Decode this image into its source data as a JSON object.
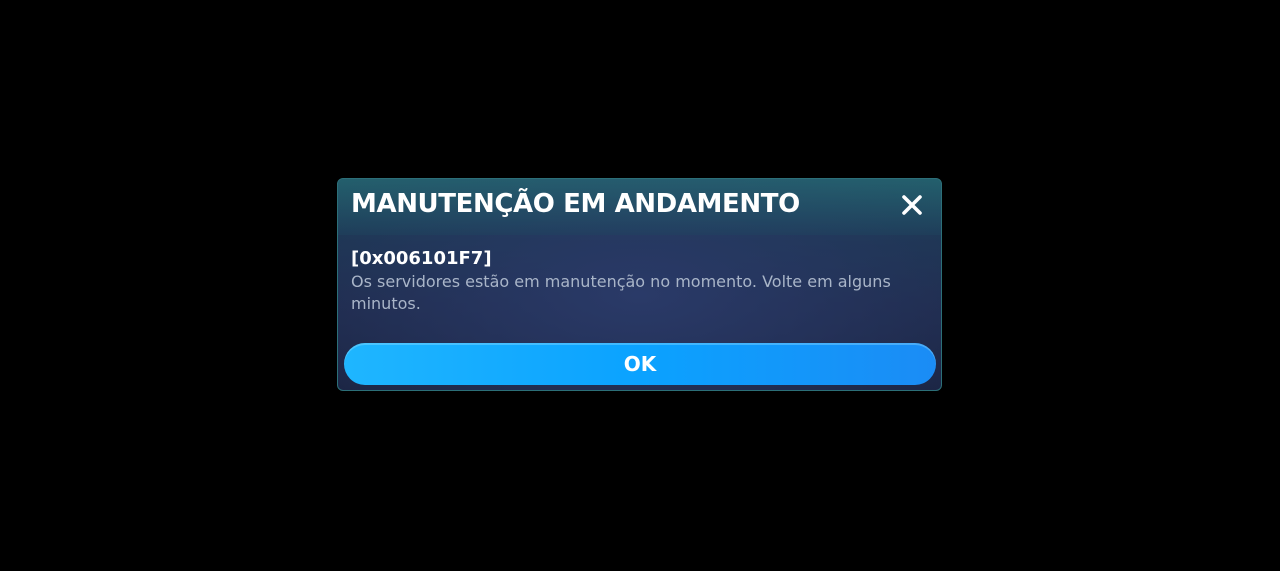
{
  "dialog": {
    "title": "MANUTENÇÃO EM ANDAMENTO",
    "close_icon": "close-icon",
    "error_code": "[0x006101F7]",
    "message": "Os servidores estão em manutenção no momento. Volte em alguns minutos.",
    "ok_label": "OK"
  },
  "colors": {
    "background": "#000000",
    "dialog_border": "#2c6f78",
    "button": "#0ba2ff",
    "message_text": "#a9b5c8"
  }
}
